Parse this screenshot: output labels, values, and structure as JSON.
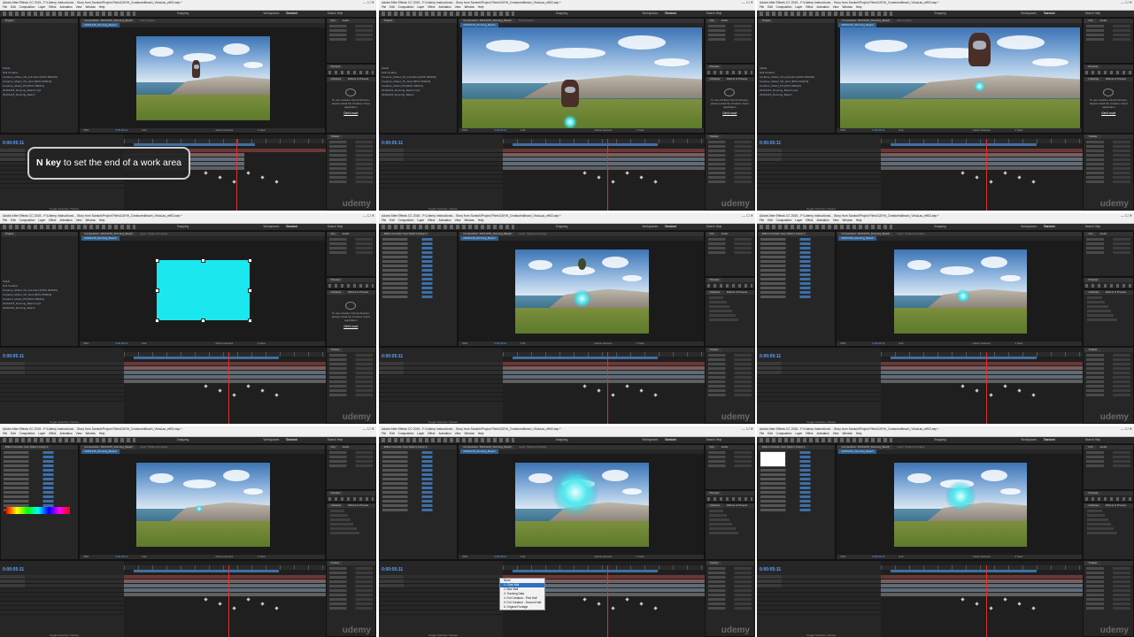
{
  "app_title": "Adobe After Effects CC 2015 - F:\\Udemy Instructions\\... Story from Scratch\\Project Files\\1\\20%\\_CreaturesBeach_ViviaLau_eff02.aep *",
  "menus": [
    "File",
    "Edit",
    "Composition",
    "Layer",
    "Effect",
    "Animation",
    "View",
    "Window",
    "Help"
  ],
  "workspace": {
    "snapping_label": "Snapping",
    "workspaces_label": "Workspaces:",
    "current": "Standard",
    "search_placeholder": "Search Help"
  },
  "panels": {
    "project": "Project",
    "composition_tab": "Composition: 20161215_Running_Beach",
    "comp_name": "20161215_Running_Beach",
    "null_creation": "Null Creation",
    "layer_tab": "Layer: Shaped Footage",
    "info": "Info",
    "audio": "Audio",
    "preview": "Preview",
    "libraries": "Libraries",
    "effects_presets": "Effects & Presets",
    "tracker": "Tracker",
    "character": "Character",
    "align": "Align",
    "toggle_switches": "Toggle Switches / Modes",
    "zoom": "50%",
    "resolution": "Full",
    "active_camera": "Active Camera",
    "view": "1 View",
    "effect_controls_tab": "Effect Controls: Gun Solid 1 Comp 1"
  },
  "project_items": [
    "Solids",
    "Null Creation",
    "Creature_Model_V8_animation [MXG 000018]",
    "Creature_Model_V8_Jan2 [MXG 000019]",
    "Creature_Model_P6 [MXG 000014]",
    "20161215_Running_Beach.mp4",
    "20161215_Running_Beach"
  ],
  "libraries_notice": {
    "text": "To use Creative Cloud Libraries, please install the Creative Cloud application",
    "link": "Get it now!"
  },
  "timecode": "0:00:05:11",
  "caption": {
    "key": "N key",
    "rest": " to set the end of a work area"
  },
  "watermark": "udemy",
  "context_menu": {
    "items": [
      "None",
      "1. Glow Null",
      "2. Blue Ball",
      "3. Tracking Data",
      "4. Full Creature - First Half",
      "5. Full Creature - Second Half",
      "6. Original Footage"
    ],
    "selected_index": 1
  }
}
